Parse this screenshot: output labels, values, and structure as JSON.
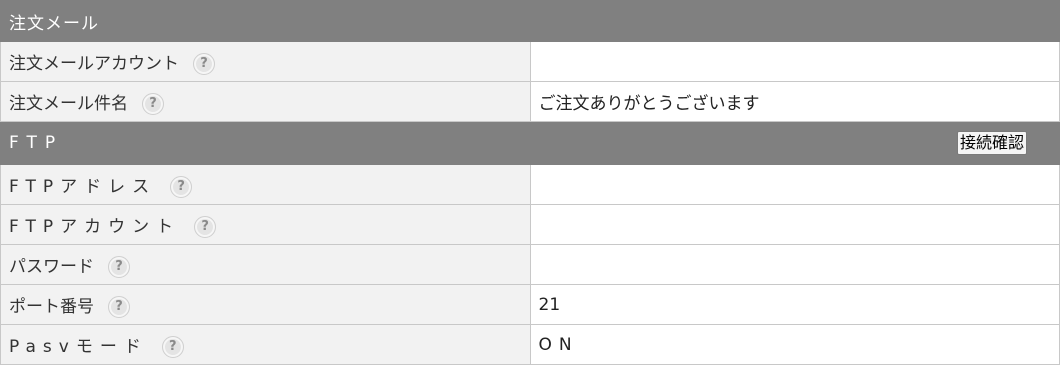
{
  "sections": {
    "order_mail": {
      "title": "注文メール",
      "rows": [
        {
          "label": "注文メールアカウント",
          "help": "?",
          "value": ""
        },
        {
          "label": "注文メール件名",
          "help": "?",
          "value": "ご注文ありがとうございます"
        }
      ]
    },
    "ftp": {
      "title": "FTP",
      "connect_button": "接続確認",
      "rows": [
        {
          "label": "FTPアドレス",
          "help": "?",
          "value": ""
        },
        {
          "label": "FTPアカウント",
          "help": "?",
          "value": ""
        },
        {
          "label": "パスワード",
          "help": "?",
          "value": ""
        },
        {
          "label": "ポート番号",
          "help": "?",
          "value": "21"
        },
        {
          "label": "Pasvモード",
          "help": "?",
          "value": "ON"
        }
      ]
    }
  },
  "colors": {
    "header_bg": "#808080",
    "label_bg": "#f2f2f2",
    "border": "#c8c8c8"
  },
  "icons": {
    "help": "question-circle-icon"
  }
}
